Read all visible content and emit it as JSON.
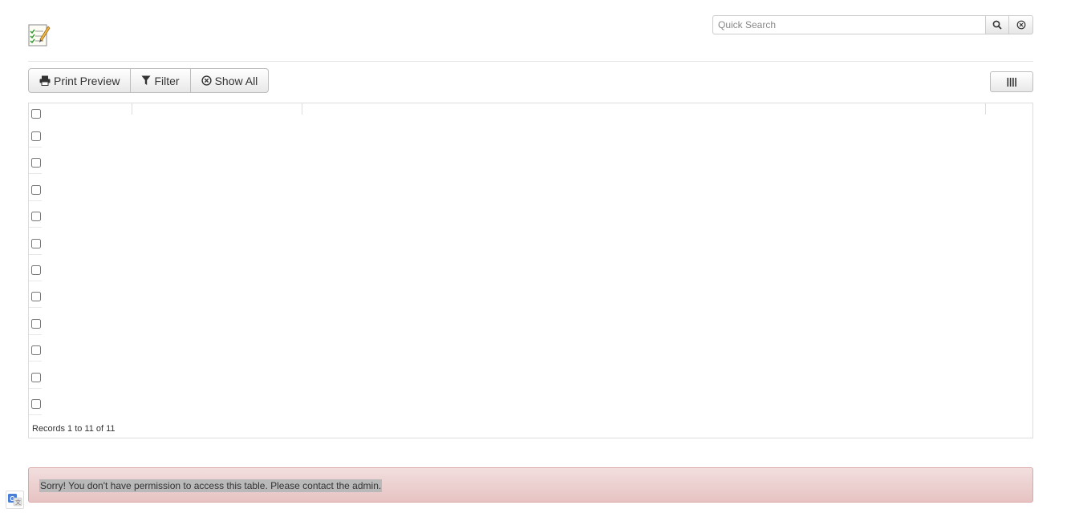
{
  "header": {
    "logo_icon": "notepad-checklist-icon",
    "search": {
      "placeholder": "Quick Search",
      "value": ""
    }
  },
  "toolbar": {
    "print_preview_label": "Print Preview",
    "filter_label": "Filter",
    "show_all_label": "Show All"
  },
  "grid": {
    "row_count": 11,
    "footer": "Records 1 to 11 of 11"
  },
  "alert": {
    "message": "Sorry! You don't have permission to access this table. Please contact the admin."
  },
  "colors": {
    "alert_bg": "#f2dede",
    "alert_border": "#dca7a7"
  }
}
